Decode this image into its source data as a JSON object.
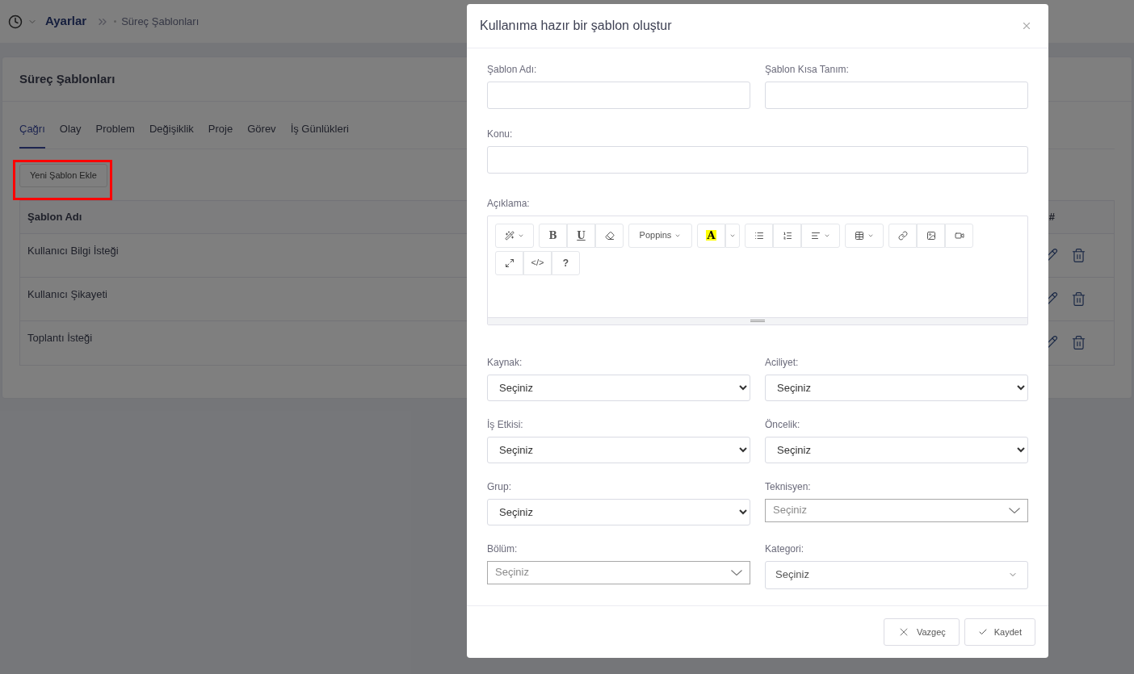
{
  "breadcrumb": {
    "root": "Ayarlar",
    "current": "Süreç Şablonları"
  },
  "card": {
    "title": "Süreç Şablonları"
  },
  "tabs": [
    {
      "label": "Çağrı",
      "selected": true
    },
    {
      "label": "Olay",
      "selected": false
    },
    {
      "label": "Problem",
      "selected": false
    },
    {
      "label": "Değişiklik",
      "selected": false
    },
    {
      "label": "Proje",
      "selected": false
    },
    {
      "label": "Görev",
      "selected": false
    },
    {
      "label": "İş Günlükleri",
      "selected": false
    }
  ],
  "add_button": "Yeni Şablon Ekle",
  "table": {
    "columns": [
      "Şablon Adı",
      "#"
    ],
    "rows": [
      {
        "name": "Kullanıcı Bilgi İsteği"
      },
      {
        "name": "Kullanıcı Şikayeti"
      },
      {
        "name": "Toplantı İsteği"
      }
    ]
  },
  "modal": {
    "title": "Kullanıma hazır bir şablon oluştur",
    "top_fields": [
      {
        "label": "Şablon Adı:"
      },
      {
        "label": "Şablon Kısa Tanım:"
      }
    ],
    "subject_field": {
      "label": "Konu:"
    },
    "editor": {
      "label": "Açıklama:",
      "font": "Poppins",
      "bold": "B",
      "underline": "U",
      "highlight_letter": "A",
      "code": "</>",
      "help": "?"
    },
    "select_fields": [
      {
        "label": "Kaynak:",
        "kind": "select",
        "value": "Seçiniz"
      },
      {
        "label": "Aciliyet:",
        "kind": "select",
        "value": "Seçiniz"
      },
      {
        "label": "İş Etkisi:",
        "kind": "select",
        "value": "Seçiniz"
      },
      {
        "label": "Öncelik:",
        "kind": "select",
        "value": "Seçiniz"
      },
      {
        "label": "Grup:",
        "kind": "select",
        "value": "Seçiniz"
      },
      {
        "label": "Teknisyen:",
        "kind": "combo",
        "placeholder": "Seçiniz"
      },
      {
        "label": "Bölüm:",
        "kind": "combo",
        "placeholder": "Seçiniz"
      },
      {
        "label": "Kategori:",
        "kind": "picker",
        "value": "Seçiniz"
      }
    ],
    "buttons": [
      {
        "label": "Vazgeç",
        "kind": "cancel"
      },
      {
        "label": "Kaydet",
        "kind": "save"
      }
    ]
  }
}
